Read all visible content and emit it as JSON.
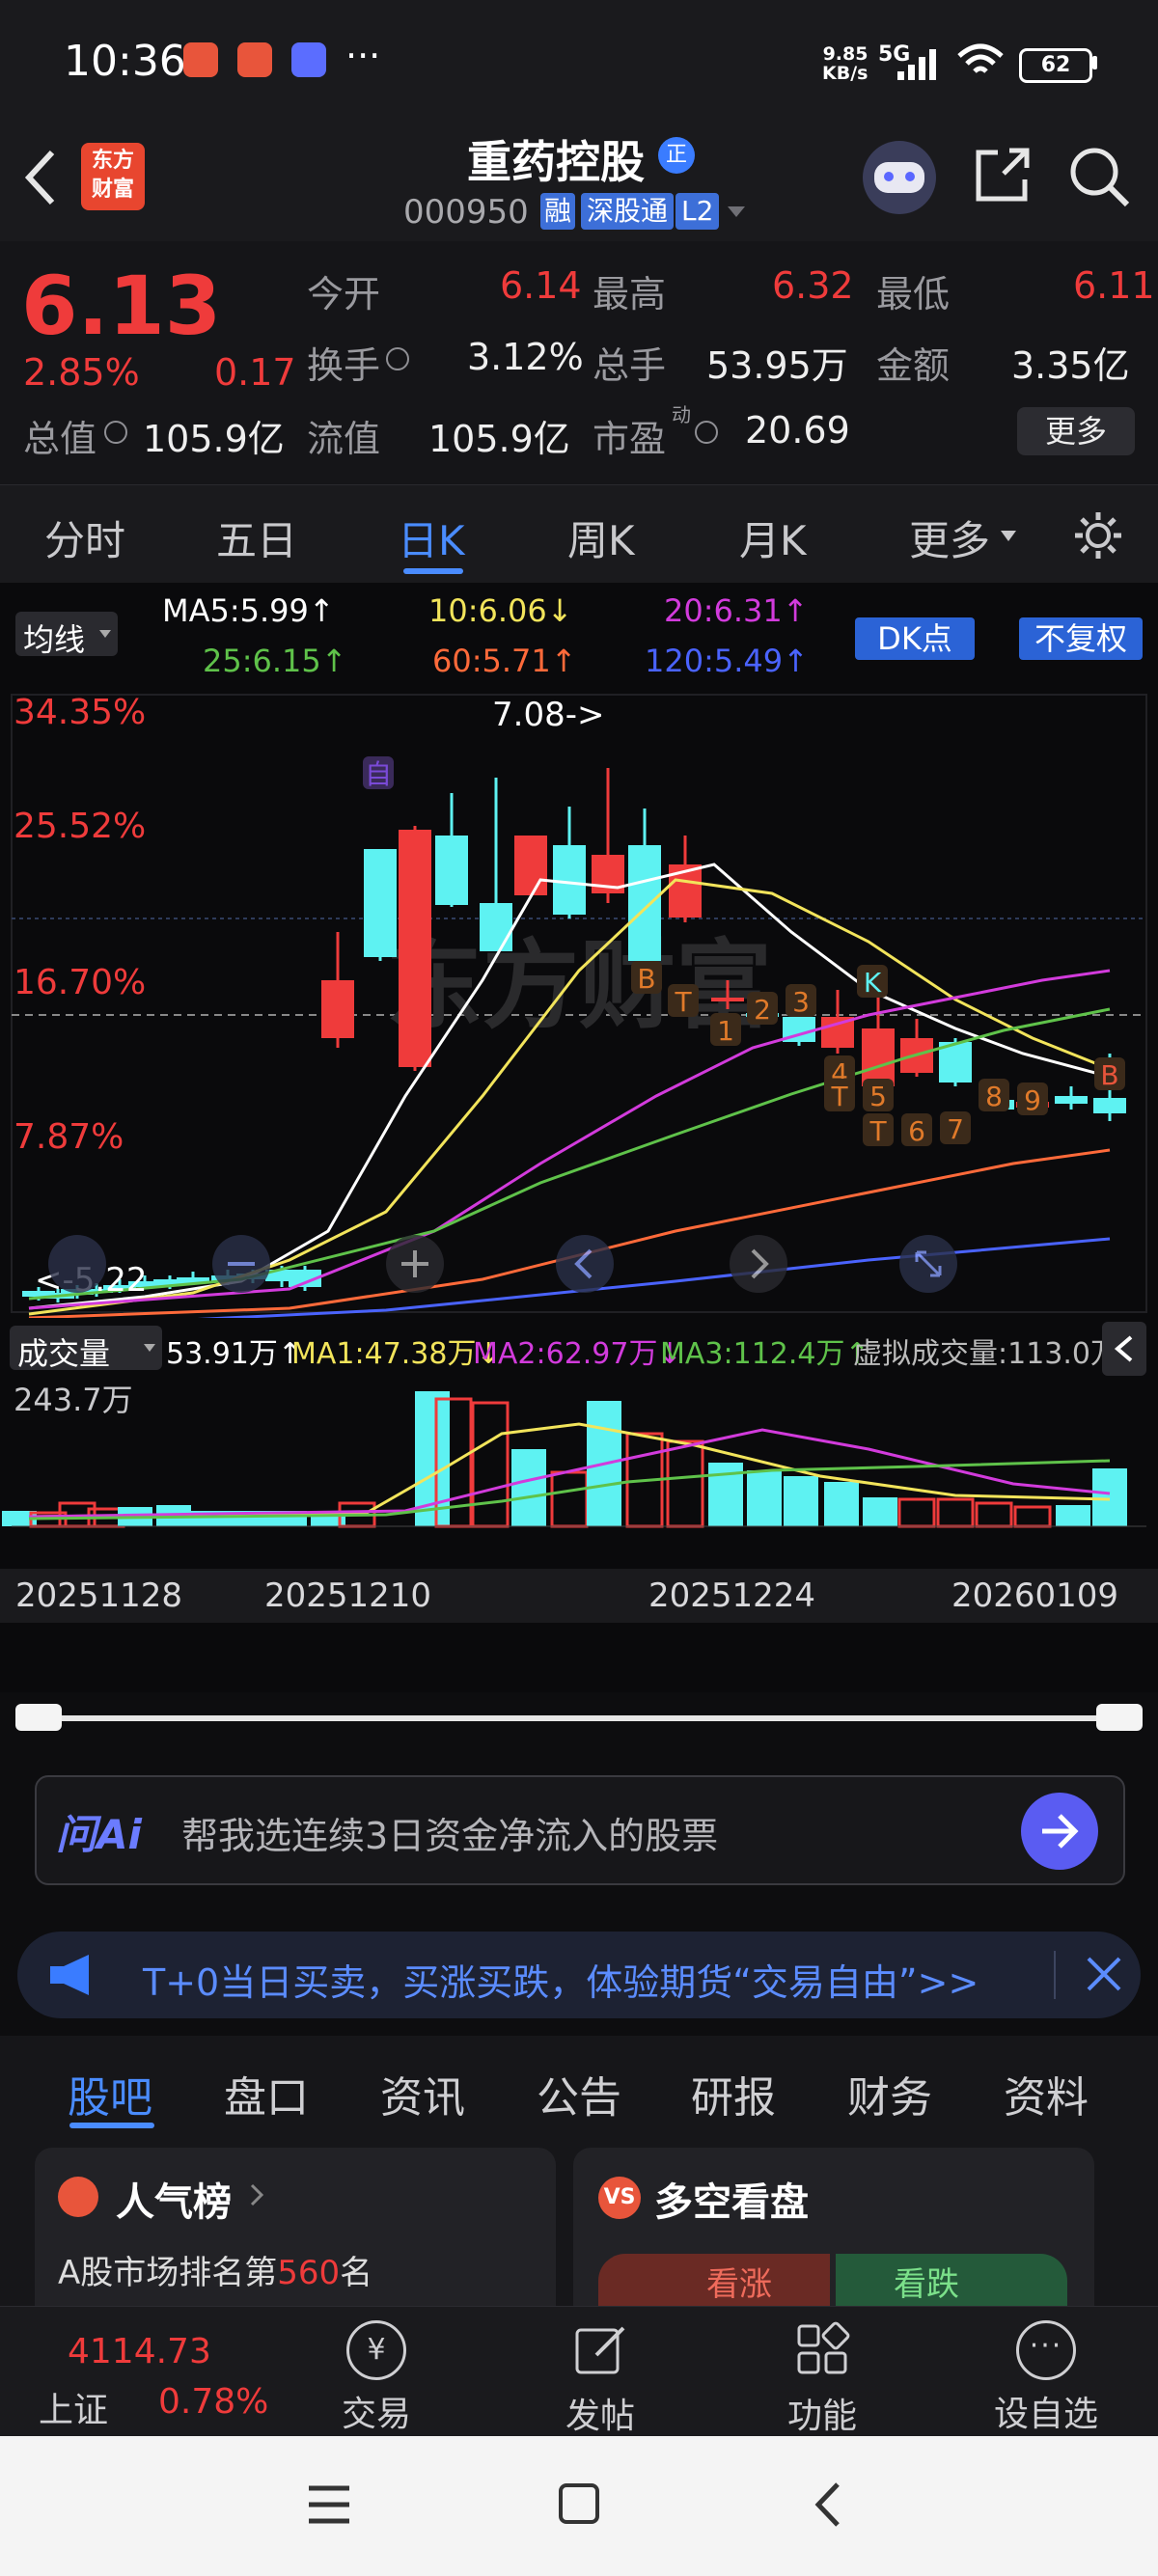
{
  "status_bar": {
    "time": "10:36",
    "dots": "···",
    "net_speed_value": "9.85",
    "net_speed_unit": "KB/s",
    "network": "5G",
    "battery": "62"
  },
  "nav": {
    "logo_line1": "东方",
    "logo_line2": "财富",
    "stock_name": "重药控股",
    "badge_zheng": "正",
    "stock_code": "000950",
    "tag_rong": "融",
    "tag_sgt": "深股通",
    "tag_l2": "L2"
  },
  "quote": {
    "price": "6.13",
    "change_pct": "2.85%",
    "change_amt": "0.17",
    "open_label": "今开",
    "open_value": "6.14",
    "high_label": "最高",
    "high_value": "6.32",
    "low_label": "最低",
    "low_value": "6.11",
    "turnover_label": "换手",
    "turnover_value": "3.12%",
    "volume_label": "总手",
    "volume_value": "53.95万",
    "amount_label": "金额",
    "amount_value": "3.35亿",
    "mktcap_label": "总值",
    "mktcap_value": "105.9亿",
    "float_label": "流值",
    "float_value": "105.9亿",
    "pe_label": "市盈",
    "pe_sup": "动",
    "pe_value": "20.69",
    "more_button": "更多"
  },
  "period_tabs": [
    "分时",
    "五日",
    "日K",
    "周K",
    "月K",
    "更多"
  ],
  "active_tab": "日K",
  "ma_bar": {
    "label": "均线",
    "ma5": "MA5:5.99↑",
    "ma10": "10:6.06↓",
    "ma20": "20:6.31↑",
    "ma25": "25:6.15↑",
    "ma60": "60:5.71↑",
    "ma120": "120:5.49↑",
    "dk_button": "DK点",
    "fq_button": "不复权"
  },
  "price_axis": [
    "34.35%",
    "25.52%",
    "16.70%",
    "7.87%"
  ],
  "annotations": {
    "high_marker": "7.08->",
    "low_marker": "<-5.22",
    "zi_label": "自",
    "watermark": "东方财富"
  },
  "volume_bar": {
    "label": "成交量",
    "vol": "53.91万↑",
    "ma1": "MA1:47.38万↓",
    "ma2": "MA2:62.97万↓",
    "ma3": "MA3:112.4万↑",
    "virtual": "虚拟成交量:113.0万",
    "max_label": "243.7万"
  },
  "colors": {
    "up": "#ef3b3b",
    "down": "#5ef2f2",
    "ma5": "#ffffff",
    "ma10": "#f2e45b",
    "ma20": "#d23bdc",
    "ma25": "#5fc24a",
    "ma60": "#ff6a3a",
    "ma120": "#4a63ff",
    "accent": "#4a7cff"
  },
  "dates": [
    "20251128",
    "20251210",
    "20251224",
    "20260109"
  ],
  "ask": {
    "logo": "问Ai",
    "placeholder": "帮我选连续3日资金净流入的股票"
  },
  "banner": {
    "text": "T+0当日买卖，买涨买跌，体验期货“交易自由”>>"
  },
  "bottom_tabs": [
    "股吧",
    "盘口",
    "资讯",
    "公告",
    "研报",
    "财务",
    "资料"
  ],
  "cards": {
    "popularity_title": "人气榜",
    "popularity_text_prefix": "A股市场排名第",
    "popularity_rank": "560",
    "popularity_text_suffix": "名",
    "vs_badge": "VS",
    "longshort_title": "多空看盘",
    "bull_label": "看涨",
    "bear_label": "看跌"
  },
  "footer": {
    "index_value": "4114.73",
    "index_name": "上证",
    "index_change": "0.78%",
    "trade": "交易",
    "post": "发帖",
    "features": "功能",
    "watchlist": "设自选"
  },
  "chart_data": {
    "type": "candlestick",
    "y_axis_labels": [
      "34.35%",
      "25.52%",
      "16.70%",
      "7.87%"
    ],
    "x_labels": [
      "20251128",
      "20251210",
      "20251224",
      "20260109"
    ],
    "marks": [
      "自",
      "B",
      "T",
      "1",
      "2",
      "3",
      "K",
      "4",
      "T",
      "5",
      "T",
      "6",
      "7",
      "8",
      "9",
      "B"
    ]
  }
}
